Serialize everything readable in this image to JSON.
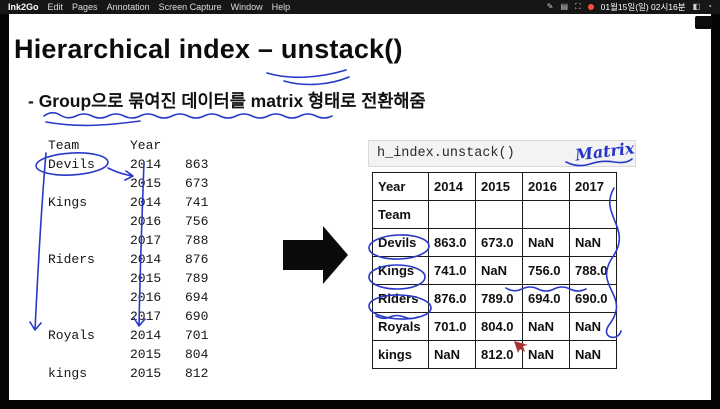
{
  "menu_bar": {
    "app_name": "Ink2Go",
    "items": [
      "Edit",
      "Pages",
      "Annotation",
      "Screen Capture",
      "Window",
      "Help"
    ],
    "status": {
      "icons": [
        {
          "name": "pen-icon",
          "glyph": "✎"
        },
        {
          "name": "pages-icon",
          "glyph": "▤"
        },
        {
          "name": "capture-icon",
          "glyph": "⛶"
        }
      ],
      "datetime": "01월15일(일) 02시16분",
      "right_icons": [
        {
          "name": "display-icon",
          "glyph": "◧"
        },
        {
          "name": "clock-icon",
          "glyph": "◔"
        }
      ]
    }
  },
  "slide": {
    "title": "Hierarchical index – unstack()",
    "bullet": "- Group으로 묶여진 데이터를 matrix 형태로 전환해줌",
    "left_table": {
      "col1": "Team",
      "col2": "Year",
      "rows": [
        [
          "Devils",
          "2014",
          "863"
        ],
        [
          "",
          "2015",
          "673"
        ],
        [
          "Kings",
          "2014",
          "741"
        ],
        [
          "",
          "2016",
          "756"
        ],
        [
          "",
          "2017",
          "788"
        ],
        [
          "Riders",
          "2014",
          "876"
        ],
        [
          "",
          "2015",
          "789"
        ],
        [
          "",
          "2016",
          "694"
        ],
        [
          "",
          "2017",
          "690"
        ],
        [
          "Royals",
          "2014",
          "701"
        ],
        [
          "",
          "2015",
          "804"
        ],
        [
          "kings",
          "2015",
          "812"
        ]
      ]
    },
    "code": "h_index.unstack()",
    "matrix_note": "Matrix",
    "result_table": {
      "corner": "Year",
      "index_name": "Team",
      "columns": [
        "2014",
        "2015",
        "2016",
        "2017"
      ],
      "rows": [
        [
          "Devils",
          "863.0",
          "673.0",
          "NaN",
          "NaN"
        ],
        [
          "Kings",
          "741.0",
          "NaN",
          "756.0",
          "788.0"
        ],
        [
          "Riders",
          "876.0",
          "789.0",
          "694.0",
          "690.0"
        ],
        [
          "Royals",
          "701.0",
          "804.0",
          "NaN",
          "NaN"
        ],
        [
          "kings",
          "NaN",
          "812.0",
          "NaN",
          "NaN"
        ]
      ]
    }
  },
  "colors": {
    "annotation_blue": "#2839c8",
    "record_red": "#ff4b40",
    "menu_bg": "#161616"
  }
}
